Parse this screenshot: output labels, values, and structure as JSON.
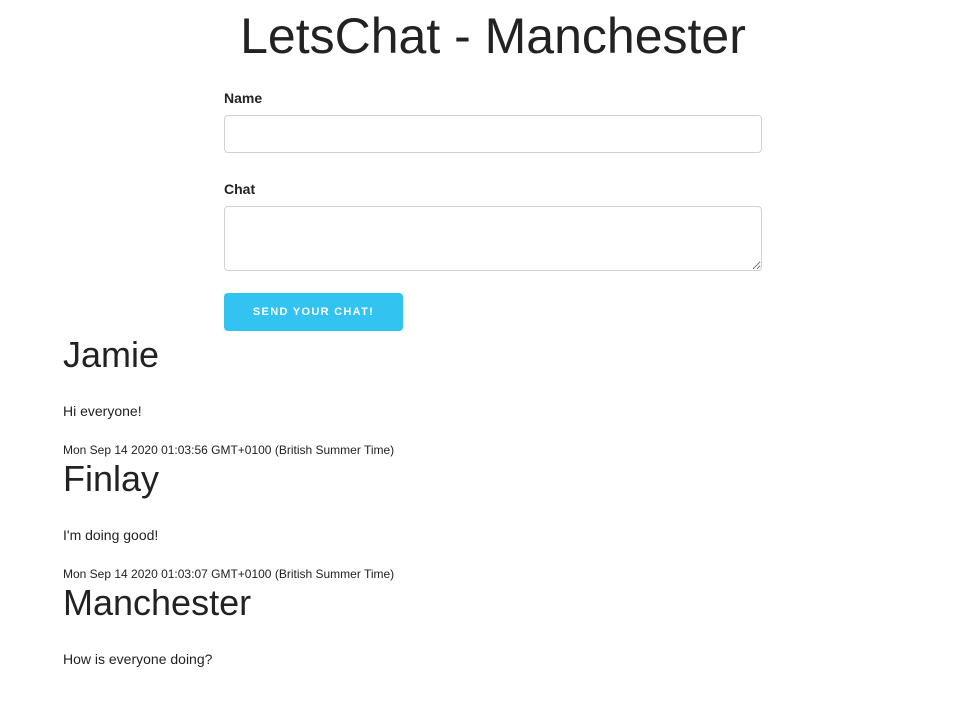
{
  "header": {
    "title": "LetsChat - Manchester"
  },
  "form": {
    "name_label": "Name",
    "name_value": "",
    "chat_label": "Chat",
    "chat_value": "",
    "submit_label": "Send your chat!"
  },
  "messages": [
    {
      "author": "Jamie",
      "text": "Hi everyone!",
      "timestamp": "Mon Sep 14 2020 01:03:56 GMT+0100 (British Summer Time)"
    },
    {
      "author": "Finlay",
      "text": "I'm doing good!",
      "timestamp": "Mon Sep 14 2020 01:03:07 GMT+0100 (British Summer Time)"
    },
    {
      "author": "Manchester",
      "text": "How is everyone doing?"
    }
  ]
}
